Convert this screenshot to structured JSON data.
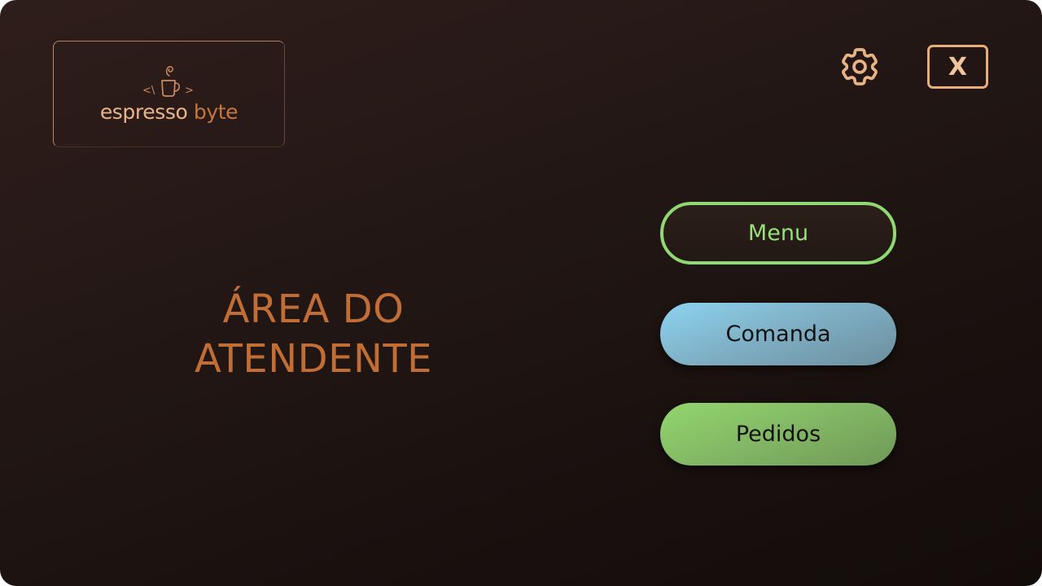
{
  "app": {
    "brand": {
      "word1": "espresso",
      "word2": "byte",
      "icon": "coffee-code-icon"
    },
    "title_line1": "ÁREA DO",
    "title_line2": "ATENDENTE"
  },
  "toolbar": {
    "settings_icon": "gear-icon",
    "close_label": "X"
  },
  "nav": {
    "menu_label": "Menu",
    "comanda_label": "Comanda",
    "pedidos_label": "Pedidos"
  },
  "colors": {
    "accent": "#c06e35",
    "menu_border": "#90d872",
    "comanda": "#8dd3ef",
    "pedidos": "#93d66e"
  }
}
